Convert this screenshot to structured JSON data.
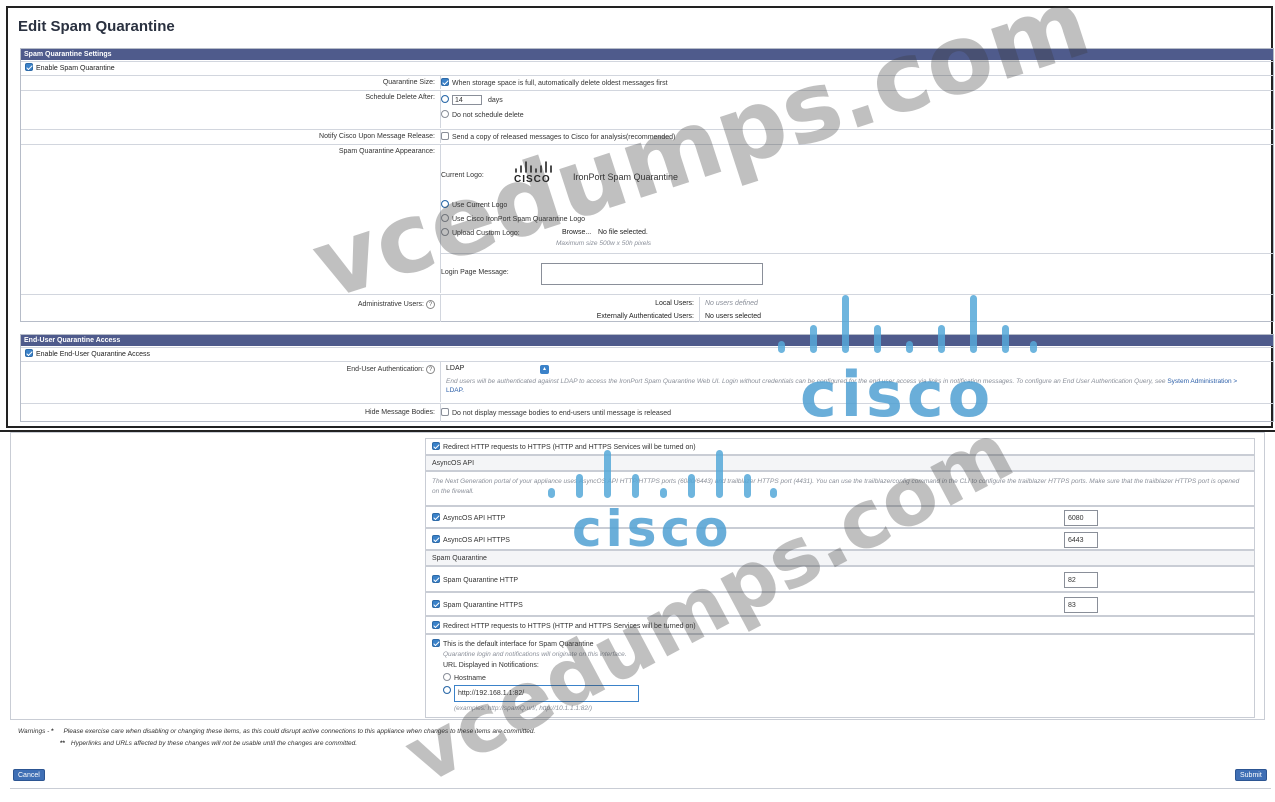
{
  "page_title": "Edit Spam Quarantine",
  "settings": {
    "header": "Spam Quarantine Settings",
    "enable_label": "Enable Spam Quarantine",
    "enable_checked": true,
    "quarantine_size_label": "Quarantine Size:",
    "quarantine_size_option": "When storage space is full, automatically delete oldest messages first",
    "schedule_label": "Schedule Delete After:",
    "schedule_days_value": "14",
    "schedule_days_unit": "days",
    "schedule_no_delete": "Do not schedule delete",
    "notify_label": "Notify Cisco Upon Message Release:",
    "notify_option": "Send a copy of released messages to Cisco for analysis(recommended)",
    "appearance_label": "Spam Quarantine Appearance:",
    "current_logo_label": "Current Logo:",
    "logo_word": "CISCO",
    "logo_product": "IronPort Spam Quarantine",
    "use_current_logo": "Use Current Logo",
    "use_cisco_logo": "Use Cisco IronPort Spam Quarantine Logo",
    "upload_custom_logo": "Upload Custom Logo:",
    "browse_button": "Browse...",
    "no_file": "No file selected.",
    "max_size_hint": "Maximum size 500w x 50h pixels",
    "login_message_label": "Login Page Message:",
    "admin_users_label": "Administrative Users:",
    "local_users_label": "Local Users:",
    "local_users_value": "No users defined",
    "ext_users_label": "Externally Authenticated Users:",
    "ext_users_value": "No users selected"
  },
  "enduser": {
    "header": "End-User Quarantine Access",
    "enable_label": "Enable End-User Quarantine Access",
    "auth_label": "End-User Authentication:",
    "auth_selected": "LDAP",
    "auth_help_text": "End users will be authenticated against LDAP to access the IronPort Spam Quarantine Web UI. Login without credentials can be configured for the end user access via links in notification messages. To configure an End User Authentication Query, see",
    "auth_help_link": "System Administration > LDAP.",
    "hide_bodies_label": "Hide Message Bodies:",
    "hide_bodies_option": "Do not display message bodies to end-users until message is released"
  },
  "interface": {
    "redirect_top": "Redirect HTTP requests to HTTPS (HTTP and HTTPS Services will be turned on)",
    "asyncos_api_heading": "AsyncOS API",
    "asyncos_api_note": "The Next Generation portal of your appliance uses AsyncOS API HTTP/HTTPS ports (6080/6443) and trailblazer HTTPS port (4431). You can use the trailblazerconfig command in the CLI to configure the trailblazer HTTPS ports. Make sure that the trailblazer HTTPS port is opened on the firewall.",
    "api_http_label": "AsyncOS API HTTP",
    "api_http_port": "6080",
    "api_https_label": "AsyncOS API HTTPS",
    "api_https_port": "6443",
    "spam_heading": "Spam Quarantine",
    "sq_http_label": "Spam Quarantine HTTP",
    "sq_http_port": "82",
    "sq_https_label": "Spam Quarantine HTTPS",
    "sq_https_port": "83",
    "redirect_bottom": "Redirect HTTP requests to HTTPS (HTTP and HTTPS Services will be turned on)",
    "default_interface_label": "This is the default interface for Spam Quarantine",
    "default_interface_note": "Quarantine login and notifications will originate on this interface.",
    "url_label": "URL Displayed in Notifications:",
    "hostname_option": "Hostname",
    "url_value": "http://192.168.1.1:82/",
    "url_examples": "(examples: http://spamQ.url/, http://10.1.1.1:82/)"
  },
  "warnings": {
    "prefix": "Warnings -",
    "star1": "*",
    "line1": "Please exercise care when disabling or changing these items, as this could disrupt active connections to this appliance when changes to these items are committed.",
    "star2": "**",
    "line2": "Hyperlinks and URLs affected by these changes will not be usable until the changes are committed."
  },
  "buttons": {
    "cancel": "Cancel",
    "submit": "Submit"
  },
  "watermarks": {
    "w1": "vcedumps.com",
    "w2": "cisco",
    "w3": "vcedumps.com",
    "w4": "cisco"
  },
  "colors": {
    "section_header": "#4f5b8c",
    "accent": "#3b82c9",
    "cisco_blue": "#55a8d8"
  }
}
